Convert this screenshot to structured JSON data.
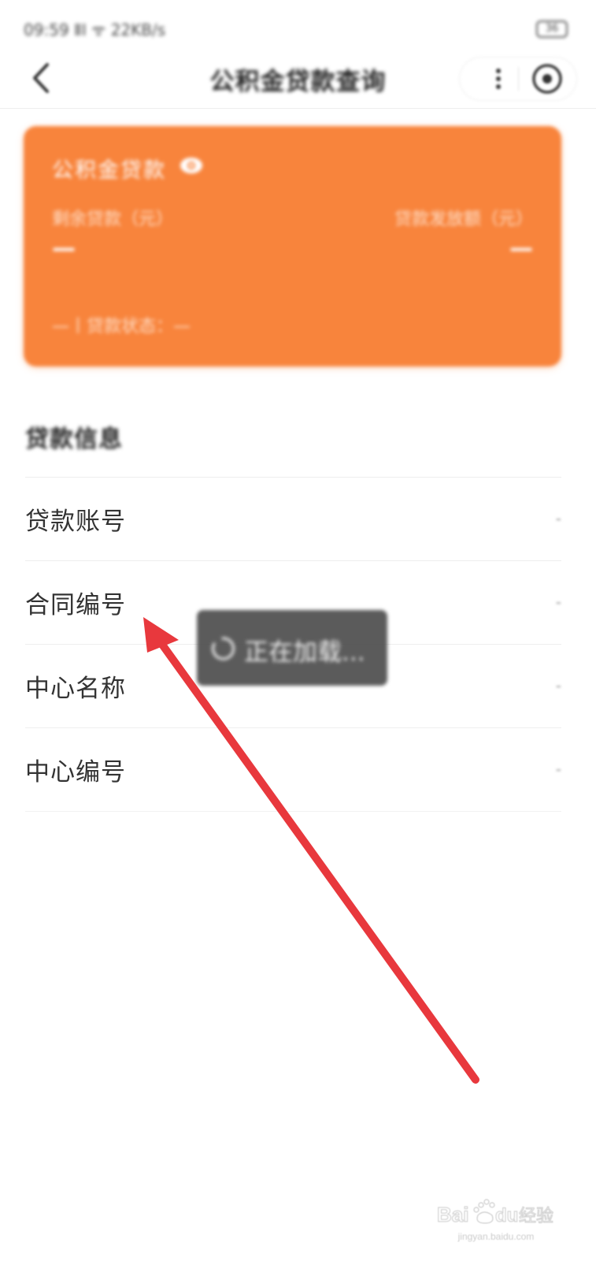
{
  "status_bar": {
    "text": "09:59 ⅡⅠ ᯤ 22KB/s",
    "battery": "36"
  },
  "nav": {
    "title": "公积金贷款查询",
    "icons": [
      "back-chevron",
      "more-vertical",
      "close-circle"
    ]
  },
  "loan_card": {
    "title": "公积金贷款",
    "left_label": "剩余贷款（元）",
    "right_label": "贷款发放额（元）",
    "left_value": "—",
    "right_value": "—",
    "status": "—丨贷款状态：—",
    "background_color": "#f8843c"
  },
  "section": {
    "title": "贷款信息"
  },
  "info_rows": [
    {
      "label": "贷款账号",
      "value": "-"
    },
    {
      "label": "合同编号",
      "value": "-"
    },
    {
      "label": "中心名称",
      "value": "-"
    },
    {
      "label": "中心编号",
      "value": "-"
    }
  ],
  "toast": {
    "text": "正在加载..."
  },
  "annotation": {
    "type": "red-arrow",
    "color": "#e8383d"
  },
  "watermark": {
    "logo_text": "Bai du 经验",
    "url": "jingyan.baidu.com"
  }
}
